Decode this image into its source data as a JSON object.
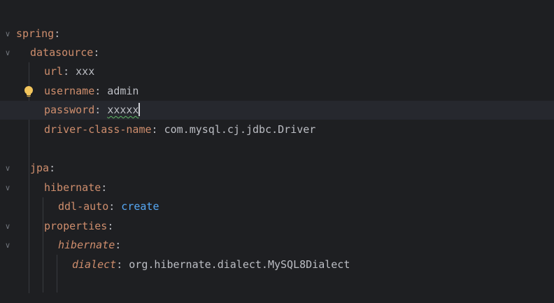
{
  "lines": [
    {
      "key": "spring",
      "sep": ":",
      "value": ""
    },
    {
      "key": "datasource",
      "sep": ":",
      "value": ""
    },
    {
      "key": "url",
      "sep": ":",
      "value": " xxx"
    },
    {
      "key": "username",
      "sep": ":",
      "value": " admin"
    },
    {
      "key": "password",
      "sep": ":",
      "value": "xxxxx"
    },
    {
      "key": "driver-class-name",
      "sep": ":",
      "value": " com.mysql.cj.jdbc.Driver"
    },
    {
      "key": "jpa",
      "sep": ":",
      "value": ""
    },
    {
      "key": "hibernate",
      "sep": ":",
      "value": ""
    },
    {
      "key": "ddl-auto",
      "sep": ":",
      "value": " create"
    },
    {
      "key": "properties",
      "sep": ":",
      "value": ""
    },
    {
      "key": "hibernate",
      "sep": ":",
      "value": ""
    },
    {
      "key": "dialect",
      "sep": ":",
      "value": " org.hibernate.dialect.MySQL8Dialect"
    }
  ],
  "icons": {
    "fold": "chevron-down-icon",
    "intention": "lightbulb-icon"
  },
  "colors": {
    "background": "#1e1f22",
    "current_line": "#26282e",
    "key": "#cf8e6d",
    "value": "#bcbec4",
    "keyword_value": "#56a8f5",
    "bulb": "#f2c55c",
    "typo_underline": "#5fb865"
  }
}
